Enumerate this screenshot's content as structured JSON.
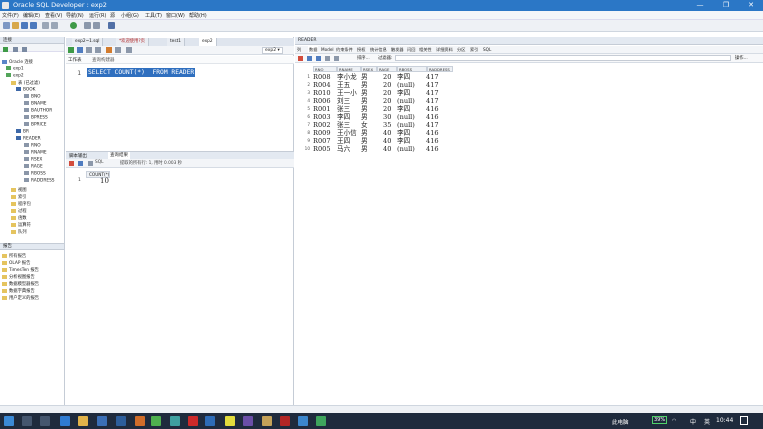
{
  "window": {
    "title": "Oracle SQL Developer : exp2",
    "controls": [
      "—",
      "❐",
      "✕"
    ]
  },
  "menu": {
    "items": [
      "文件(F)",
      "编辑(E)",
      "查看(V)",
      "导航(N)",
      "运行(R)",
      "源",
      "小组(G)",
      "工具(T)",
      "窗口(W)",
      "帮助(H)"
    ]
  },
  "connections": {
    "title": "连接",
    "tree": [
      {
        "label": "Oracle 连接",
        "level": 0
      },
      {
        "label": "exp1",
        "level": 1
      },
      {
        "label": "exp2",
        "level": 1
      },
      {
        "label": "表 (已过滤)",
        "level": 2
      },
      {
        "label": "BOOK",
        "level": 3
      },
      {
        "label": "BNO",
        "level": 4
      },
      {
        "label": "BNAME",
        "level": 4
      },
      {
        "label": "BAUTHOR",
        "level": 4
      },
      {
        "label": "BPRESS",
        "level": 4
      },
      {
        "label": "BPRICE",
        "level": 4
      },
      {
        "label": "BR",
        "level": 3
      },
      {
        "label": "READER",
        "level": 3
      },
      {
        "label": "RNO",
        "level": 4
      },
      {
        "label": "RNAME",
        "level": 4
      },
      {
        "label": "RSEX",
        "level": 4
      },
      {
        "label": "RAGE",
        "level": 4
      },
      {
        "label": "RBOSS",
        "level": 4
      },
      {
        "label": "RADDRESS",
        "level": 4
      },
      {
        "label": "视图",
        "level": 2
      },
      {
        "label": "索引",
        "level": 2
      },
      {
        "label": "程序包",
        "level": 2
      },
      {
        "label": "过程",
        "level": 2
      },
      {
        "label": "函数",
        "level": 2
      },
      {
        "label": "运算符",
        "level": 2
      },
      {
        "label": "队列",
        "level": 2
      }
    ]
  },
  "reports": {
    "title": "报告",
    "items": [
      "所有报告",
      "OLAP 报告",
      "TimesTen 报告",
      "分析视图报告",
      "数据模型器报告",
      "数据字典报告",
      "用户定义的报告"
    ]
  },
  "tabs": [
    "exp2~1.sql",
    "*欢迎使用?页",
    "test1",
    "exp2"
  ],
  "editor": {
    "worksheet_tab": "工作表",
    "query_builder_tab": "查询构建器",
    "line_number": "1",
    "sql": "SELECT COUNT(*)  FROM READER",
    "connection": "exp2"
  },
  "results": {
    "tabs": [
      "脚本输出",
      "查询结果"
    ],
    "status": "提取的所有行: 1, 用时 0.003 秒",
    "sql_label": "SQL",
    "column": "COUNT(*)",
    "row_num": "1",
    "value": "10"
  },
  "reader": {
    "title": "READER",
    "subtabs": [
      "列",
      "数据",
      "Model",
      "约束条件",
      "授权",
      "统计信息",
      "触发器",
      "闪回",
      "相关性",
      "详细资料",
      "分区",
      "索引",
      "SQL"
    ],
    "sort_label": "排序...",
    "filter_label": "过滤器:",
    "actions_label": "操作...",
    "columns": [
      "RNO",
      "RNAME",
      "RSEX",
      "RAGE",
      "RBOSS",
      "RADDRESS"
    ],
    "rows": [
      [
        "1",
        "R008",
        "李小龙",
        "男",
        "20",
        "李四",
        "417"
      ],
      [
        "2",
        "R004",
        "王五",
        "男",
        "20",
        "(null)",
        "417"
      ],
      [
        "3",
        "R010",
        "王一小",
        "男",
        "20",
        "李四",
        "417"
      ],
      [
        "4",
        "R006",
        "刘三",
        "男",
        "20",
        "(null)",
        "417"
      ],
      [
        "5",
        "R001",
        "张三",
        "男",
        "20",
        "李四",
        "416"
      ],
      [
        "6",
        "R003",
        "李四",
        "男",
        "30",
        "(null)",
        "416"
      ],
      [
        "7",
        "R002",
        "张三",
        "女",
        "35",
        "(null)",
        "417"
      ],
      [
        "8",
        "R009",
        "王小信",
        "男",
        "40",
        "李四",
        "416"
      ],
      [
        "9",
        "R007",
        "王四",
        "男",
        "40",
        "李四",
        "416"
      ],
      [
        "10",
        "R005",
        "马六",
        "男",
        "40",
        "(null)",
        "416"
      ]
    ]
  },
  "taskbar": {
    "status_text": "此电脑",
    "battery": "39%",
    "ime": "中",
    "time": "10:44",
    "input_mode": "英"
  },
  "colors": {
    "titlebar": "#2b77c6",
    "selection": "#2f6fbf",
    "taskbar": "#1f2b3d"
  }
}
